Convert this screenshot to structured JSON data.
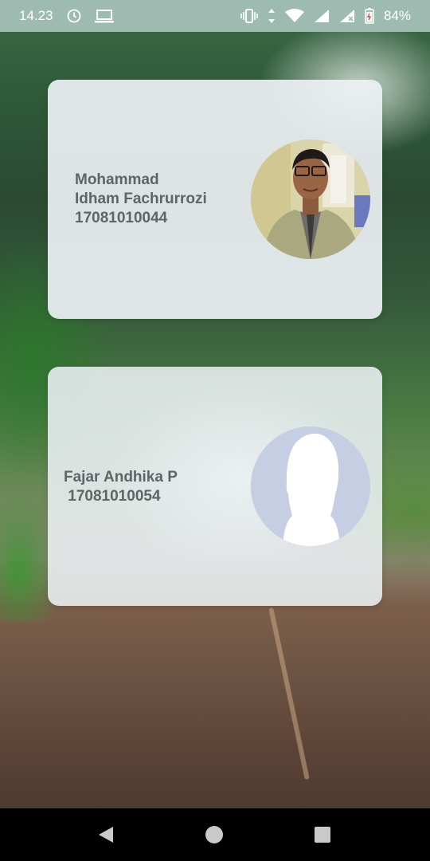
{
  "status_bar": {
    "time": "14.23",
    "battery": "84%",
    "icons": [
      "alarm-icon",
      "laptop-icon",
      "vibrate-icon",
      "data-arrows-icon",
      "wifi-icon",
      "signal-icon",
      "signal-x-icon",
      "battery-icon"
    ]
  },
  "cards": [
    {
      "name_line1": "Mohammad",
      "name_line2": "Idham Fachrurrozi",
      "student_id": "17081010044",
      "avatar": "profile-photo"
    },
    {
      "name_line1": "Fajar Andhika P",
      "student_id": " 17081010054",
      "avatar": "default-avatar-silhouette"
    }
  ],
  "nav_bar": {
    "icons": [
      "back-icon",
      "home-icon",
      "recents-icon"
    ]
  },
  "colors": {
    "status_bar_bg": "#9dbbb0",
    "card_bg": "#ecf0f3",
    "card_text": "#5f6468",
    "avatar_placeholder": "#c5cee2"
  }
}
